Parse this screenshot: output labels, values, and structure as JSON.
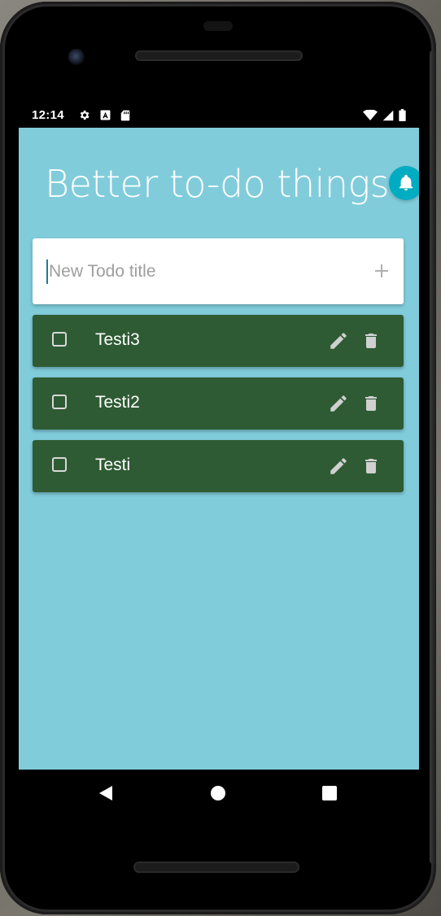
{
  "status_bar": {
    "time": "12:14"
  },
  "app": {
    "title": "Better to-do things",
    "notifications_icon": "bell-icon"
  },
  "new_todo": {
    "placeholder": "New Todo title",
    "value": "",
    "add_icon": "plus-icon"
  },
  "todos": [
    {
      "title": "Testi3",
      "checked": false
    },
    {
      "title": "Testi2",
      "checked": false
    },
    {
      "title": "Testi",
      "checked": false
    }
  ],
  "colors": {
    "screen_background": "#81ccdb",
    "todo_item_background": "#2e5b33",
    "accent": "#00acc1"
  }
}
